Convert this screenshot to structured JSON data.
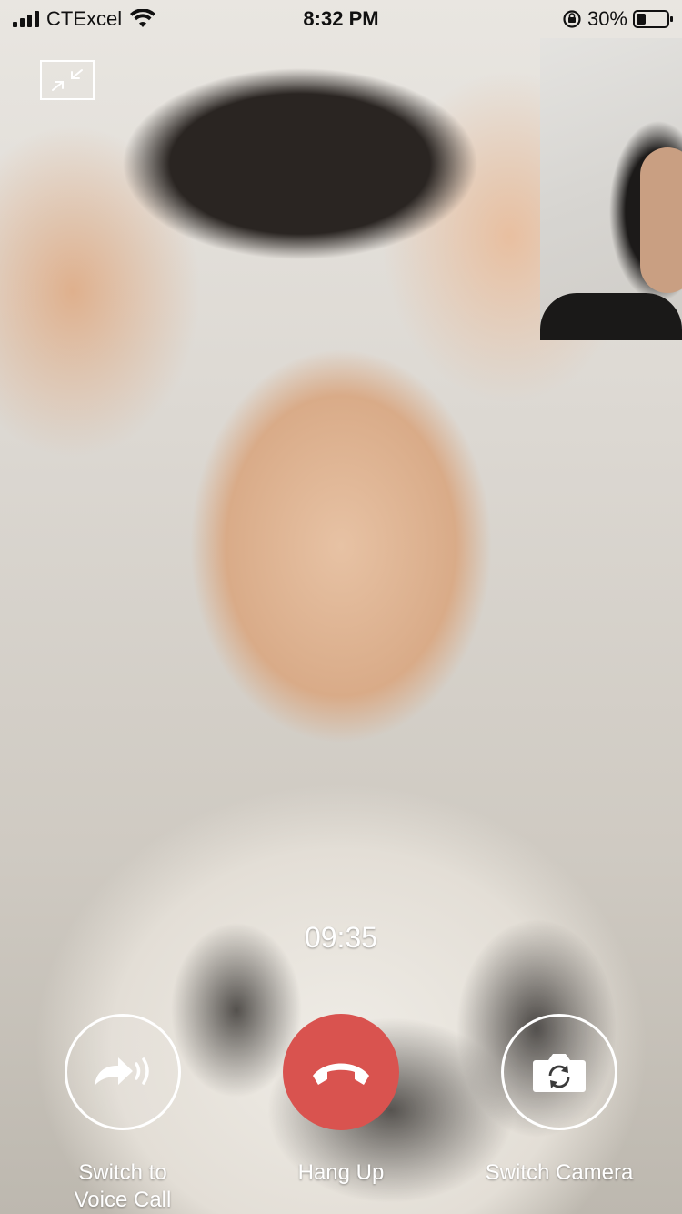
{
  "status_bar": {
    "carrier": "CTExcel",
    "time": "8:32 PM",
    "battery_percent": "30%",
    "battery_level": 0.3,
    "icons": [
      "signal-icon",
      "wifi-icon",
      "orientation-lock-icon",
      "battery-icon"
    ]
  },
  "call": {
    "duration": "09:35",
    "minimize_icon": "minimize-icon",
    "controls": {
      "voice_label": "Switch to\nVoice Call",
      "hangup_label": "Hang Up",
      "camera_label": "Switch Camera"
    }
  },
  "colors": {
    "hangup": "#d9534f",
    "text": "#ffffff",
    "status_text": "#111111"
  }
}
